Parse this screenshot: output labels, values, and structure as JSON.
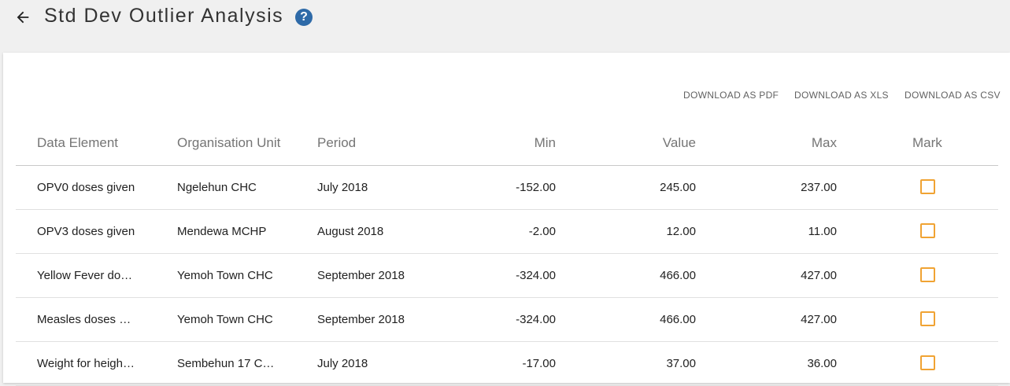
{
  "header": {
    "title": "Std Dev Outlier Analysis",
    "help_glyph": "?",
    "back_icon": "arrow-left-icon",
    "help_icon": "help-circle-icon"
  },
  "downloads": {
    "pdf": "DOWNLOAD AS PDF",
    "xls": "DOWNLOAD AS XLS",
    "csv": "DOWNLOAD AS CSV"
  },
  "table": {
    "columns": {
      "data_element": "Data Element",
      "org_unit": "Organisation Unit",
      "period": "Period",
      "min": "Min",
      "value": "Value",
      "max": "Max",
      "mark": "Mark"
    },
    "rows": [
      {
        "data_element": "OPV0 doses given",
        "org_unit": "Ngelehun CHC",
        "period": "July 2018",
        "min": "-152.00",
        "value": "245.00",
        "max": "237.00",
        "marked": false
      },
      {
        "data_element": "OPV3 doses given",
        "org_unit": "Mendewa MCHP",
        "period": "August 2018",
        "min": "-2.00",
        "value": "12.00",
        "max": "11.00",
        "marked": false
      },
      {
        "data_element": "Yellow Fever do…",
        "org_unit": "Yemoh Town CHC",
        "period": "September 2018",
        "min": "-324.00",
        "value": "466.00",
        "max": "427.00",
        "marked": false
      },
      {
        "data_element": "Measles doses …",
        "org_unit": "Yemoh Town CHC",
        "period": "September 2018",
        "min": "-324.00",
        "value": "466.00",
        "max": "427.00",
        "marked": false
      },
      {
        "data_element": "Weight for heigh…",
        "org_unit": "Sembehun 17 C…",
        "period": "July 2018",
        "min": "-17.00",
        "value": "37.00",
        "max": "36.00",
        "marked": false
      }
    ]
  },
  "colors": {
    "checkbox_border": "#f0a333",
    "help_icon_bg": "#2e6aa8"
  }
}
